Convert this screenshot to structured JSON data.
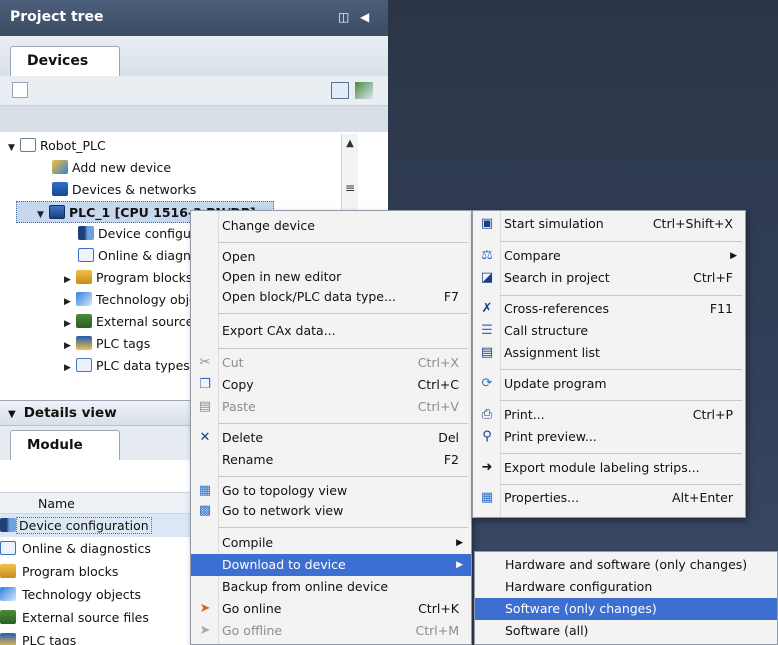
{
  "project_tree": {
    "title": "Project tree",
    "tab_devices": "Devices",
    "items": [
      {
        "label": "Robot_PLC",
        "icon": "project-icon"
      },
      {
        "label": "Add new device",
        "icon": "add-device-icon"
      },
      {
        "label": "Devices & networks",
        "icon": "network-icon"
      },
      {
        "label": "PLC_1 [CPU 1516-3 PN/DP]",
        "icon": "cpu-icon"
      },
      {
        "label": "Device configuration",
        "icon": "device-config-icon"
      },
      {
        "label": "Online & diagnostics",
        "icon": "diagnostics-icon"
      },
      {
        "label": "Program blocks",
        "icon": "program-blocks-icon"
      },
      {
        "label": "Technology objects",
        "icon": "technology-objects-icon"
      },
      {
        "label": "External source files",
        "icon": "external-sources-icon"
      },
      {
        "label": "PLC tags",
        "icon": "plc-tags-icon"
      },
      {
        "label": "PLC data types",
        "icon": "plc-data-types-icon"
      }
    ]
  },
  "details_view": {
    "title": "Details view",
    "tab_module": "Module",
    "column_name": "Name",
    "rows": [
      "Device configuration",
      "Online & diagnostics",
      "Program blocks",
      "Technology objects",
      "External source files",
      "PLC tags"
    ]
  },
  "context_menu_1": {
    "items": [
      {
        "label": "Change device",
        "shortcut": ""
      },
      {
        "label": "Open",
        "shortcut": ""
      },
      {
        "label": "Open in new editor",
        "shortcut": ""
      },
      {
        "label": "Open block/PLC data type...",
        "shortcut": "F7"
      },
      {
        "label": "Export CAx data...",
        "shortcut": ""
      },
      {
        "label": "Cut",
        "shortcut": "Ctrl+X"
      },
      {
        "label": "Copy",
        "shortcut": "Ctrl+C"
      },
      {
        "label": "Paste",
        "shortcut": "Ctrl+V"
      },
      {
        "label": "Delete",
        "shortcut": "Del"
      },
      {
        "label": "Rename",
        "shortcut": "F2"
      },
      {
        "label": "Go to topology view",
        "shortcut": ""
      },
      {
        "label": "Go to network view",
        "shortcut": ""
      },
      {
        "label": "Compile",
        "shortcut": ""
      },
      {
        "label": "Download to device",
        "shortcut": ""
      },
      {
        "label": "Backup from online device",
        "shortcut": ""
      },
      {
        "label": "Go online",
        "shortcut": "Ctrl+K"
      },
      {
        "label": "Go offline",
        "shortcut": "Ctrl+M"
      }
    ]
  },
  "context_menu_2": {
    "items": [
      {
        "label": "Start simulation",
        "shortcut": "Ctrl+Shift+X"
      },
      {
        "label": "Compare",
        "shortcut": ""
      },
      {
        "label": "Search in project",
        "shortcut": "Ctrl+F"
      },
      {
        "label": "Cross-references",
        "shortcut": "F11"
      },
      {
        "label": "Call structure",
        "shortcut": ""
      },
      {
        "label": "Assignment list",
        "shortcut": ""
      },
      {
        "label": "Update program",
        "shortcut": ""
      },
      {
        "label": "Print...",
        "shortcut": "Ctrl+P"
      },
      {
        "label": "Print preview...",
        "shortcut": ""
      },
      {
        "label": "Export module labeling strips...",
        "shortcut": ""
      },
      {
        "label": "Properties...",
        "shortcut": "Alt+Enter"
      }
    ]
  },
  "download_submenu": {
    "items": [
      "Hardware and software (only changes)",
      "Hardware configuration",
      "Software (only changes)",
      "Software (all)"
    ]
  },
  "colors": {
    "highlight": "#3c6fd1",
    "title_bar": "#4c5f7a",
    "workspace": "#2f3a4c"
  }
}
